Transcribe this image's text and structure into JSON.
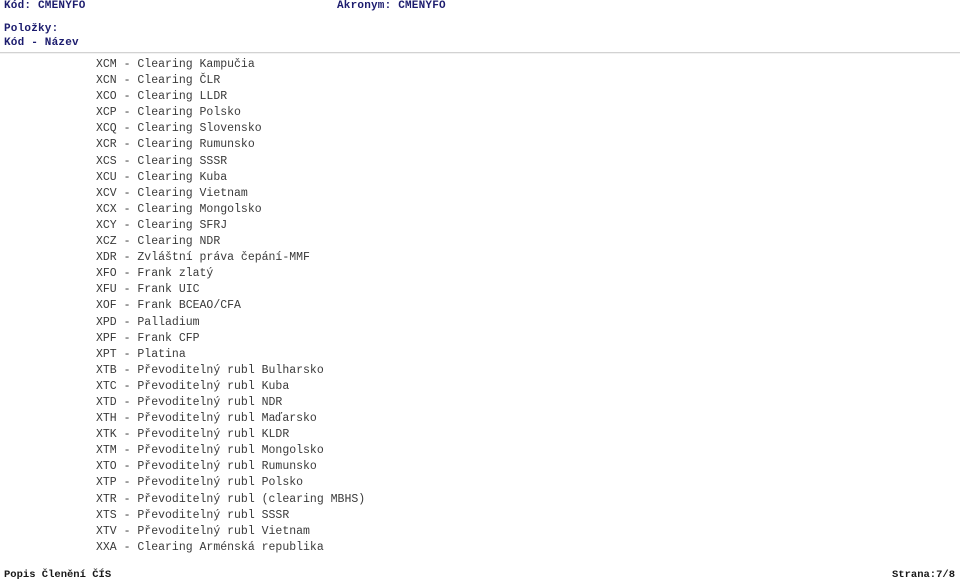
{
  "header": {
    "code_label": "Kód:",
    "code_value": "CMENYFO",
    "code_line": "Kód: CMENYFO",
    "acronym_label": "Akronym:",
    "acronym_value": "CMENYFO",
    "acronym_line": "Akronym: CMENYFO",
    "items_label": "Položky:",
    "columns_label": "Kód - Název"
  },
  "items": [
    {
      "code": "XCM",
      "name": "Clearing Kampučia",
      "line": "XCM - Clearing Kampučia"
    },
    {
      "code": "XCN",
      "name": "Clearing ČLR",
      "line": "XCN - Clearing ČLR"
    },
    {
      "code": "XCO",
      "name": "Clearing LLDR",
      "line": "XCO - Clearing LLDR"
    },
    {
      "code": "XCP",
      "name": "Clearing Polsko",
      "line": "XCP - Clearing Polsko"
    },
    {
      "code": "XCQ",
      "name": "Clearing Slovensko",
      "line": "XCQ - Clearing Slovensko"
    },
    {
      "code": "XCR",
      "name": "Clearing Rumunsko",
      "line": "XCR - Clearing Rumunsko"
    },
    {
      "code": "XCS",
      "name": "Clearing SSSR",
      "line": "XCS - Clearing SSSR"
    },
    {
      "code": "XCU",
      "name": "Clearing Kuba",
      "line": "XCU - Clearing Kuba"
    },
    {
      "code": "XCV",
      "name": "Clearing Vietnam",
      "line": "XCV - Clearing Vietnam"
    },
    {
      "code": "XCX",
      "name": "Clearing Mongolsko",
      "line": "XCX - Clearing Mongolsko"
    },
    {
      "code": "XCY",
      "name": "Clearing SFRJ",
      "line": "XCY - Clearing SFRJ"
    },
    {
      "code": "XCZ",
      "name": "Clearing NDR",
      "line": "XCZ - Clearing NDR"
    },
    {
      "code": "XDR",
      "name": "Zvláštní práva čepání-MMF",
      "line": "XDR - Zvláštní práva čepání-MMF"
    },
    {
      "code": "XFO",
      "name": "Frank zlatý",
      "line": "XFO - Frank zlatý"
    },
    {
      "code": "XFU",
      "name": "Frank UIC",
      "line": "XFU - Frank UIC"
    },
    {
      "code": "XOF",
      "name": "Frank BCEAO/CFA",
      "line": "XOF - Frank BCEAO/CFA"
    },
    {
      "code": "XPD",
      "name": "Palladium",
      "line": "XPD - Palladium"
    },
    {
      "code": "XPF",
      "name": "Frank CFP",
      "line": "XPF - Frank CFP"
    },
    {
      "code": "XPT",
      "name": "Platina",
      "line": "XPT - Platina"
    },
    {
      "code": "XTB",
      "name": "Převoditelný rubl Bulharsko",
      "line": "XTB - Převoditelný rubl Bulharsko"
    },
    {
      "code": "XTC",
      "name": "Převoditelný rubl Kuba",
      "line": "XTC - Převoditelný rubl Kuba"
    },
    {
      "code": "XTD",
      "name": "Převoditelný rubl NDR",
      "line": "XTD - Převoditelný rubl NDR"
    },
    {
      "code": "XTH",
      "name": "Převoditelný rubl Maďarsko",
      "line": "XTH - Převoditelný rubl Maďarsko"
    },
    {
      "code": "XTK",
      "name": "Převoditelný rubl KLDR",
      "line": "XTK - Převoditelný rubl KLDR"
    },
    {
      "code": "XTM",
      "name": "Převoditelný rubl Mongolsko",
      "line": "XTM - Převoditelný rubl Mongolsko"
    },
    {
      "code": "XTO",
      "name": "Převoditelný rubl Rumunsko",
      "line": "XTO - Převoditelný rubl Rumunsko"
    },
    {
      "code": "XTP",
      "name": "Převoditelný rubl Polsko",
      "line": "XTP - Převoditelný rubl Polsko"
    },
    {
      "code": "XTR",
      "name": "Převoditelný rubl (clearing MBHS)",
      "line": "XTR - Převoditelný rubl (clearing MBHS)"
    },
    {
      "code": "XTS",
      "name": "Převoditelný rubl SSSR",
      "line": "XTS - Převoditelný rubl SSSR"
    },
    {
      "code": "XTV",
      "name": "Převoditelný rubl Vietnam",
      "line": "XTV - Převoditelný rubl Vietnam"
    },
    {
      "code": "XXA",
      "name": "Clearing Arménská republika",
      "line": "XXA - Clearing Arménská republika"
    }
  ],
  "footer": {
    "title": "Popis Členění ČÍS",
    "page": "Strana:7/8"
  },
  "colors": {
    "header_text": "#1c1c6e",
    "body_text": "#3a3a3a",
    "footer_text": "#181818",
    "rule": "#d2d2d2",
    "background": "#ffffff"
  }
}
